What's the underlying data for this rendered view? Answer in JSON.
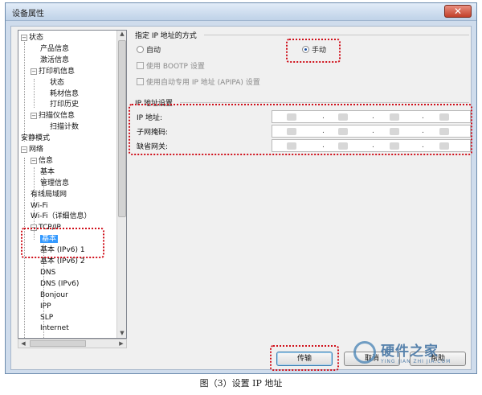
{
  "window": {
    "title": "设备属性",
    "close_symbol": "✕"
  },
  "tree": {
    "items": [
      {
        "label": "状态",
        "expander": "−"
      },
      {
        "label": "产品信息"
      },
      {
        "label": "激活信息"
      },
      {
        "label": "打印机信息",
        "expander": "−"
      },
      {
        "label": "状态"
      },
      {
        "label": "耗材信息"
      },
      {
        "label": "打印历史"
      },
      {
        "label": "扫描仪信息",
        "expander": "−"
      },
      {
        "label": "扫描计数"
      },
      {
        "label": "安静模式"
      },
      {
        "label": "网络",
        "expander": "−"
      },
      {
        "label": "信息",
        "expander": "−"
      },
      {
        "label": "基本"
      },
      {
        "label": "管理信息"
      },
      {
        "label": "有线局域网"
      },
      {
        "label": "Wi-Fi"
      },
      {
        "label": "Wi-Fi（详细信息）"
      },
      {
        "label": "TCP/IP",
        "expander": "−"
      },
      {
        "label": "基本"
      },
      {
        "label": "基本 (IPv6) 1"
      },
      {
        "label": "基本 (IPv6) 2"
      },
      {
        "label": "DNS"
      },
      {
        "label": "DNS (IPv6)"
      },
      {
        "label": "Bonjour"
      },
      {
        "label": "IPP"
      },
      {
        "label": "SLP"
      },
      {
        "label": "Internet"
      }
    ],
    "selected_index": 18
  },
  "ip_method": {
    "title": "指定 IP 地址的方式",
    "auto_label": "自动",
    "manual_label": "手动",
    "selected": "manual",
    "bootp_label": "使用 BOOTP 设置",
    "apipa_label": "使用自动专用 IP 地址 (APIPA) 设置"
  },
  "ip_settings": {
    "title": "IP 地址设置",
    "rows": [
      {
        "label": "IP 地址:"
      },
      {
        "label": "子网掩码:"
      },
      {
        "label": "缺省网关:"
      }
    ],
    "dot": "."
  },
  "buttons": {
    "send": "传输",
    "cancel": "取消",
    "help": "帮助"
  },
  "caption": "图（3）设置 IP 地址",
  "watermark": {
    "name": "硬件之家",
    "sub": "YING JIAN ZHI JIA.COM"
  },
  "colors": {
    "highlight": "#d0101b",
    "selection": "#3399ff"
  }
}
